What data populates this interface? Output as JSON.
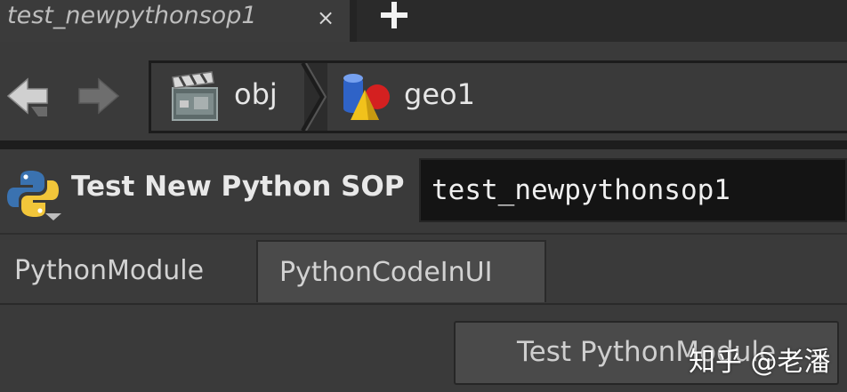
{
  "tab": {
    "title": "test_newpythonsop1",
    "close_glyph": "×"
  },
  "nav": {
    "back_icon": "back-arrow-icon",
    "forward_icon": "forward-arrow-icon"
  },
  "path": {
    "crumbs": [
      {
        "label": "obj",
        "icon": "clapperboard-icon"
      },
      {
        "label": "geo1",
        "icon": "geometry-shapes-icon"
      }
    ]
  },
  "params": {
    "operator_type": "Test New Python SOP",
    "node_name": "test_newpythonsop1"
  },
  "param_tabs": [
    {
      "label": "PythonModule"
    },
    {
      "label": "PythonCodeInUI"
    }
  ],
  "body": {
    "button_label": "Test PythonModule"
  },
  "watermark": "知乎 @老潘",
  "colors": {
    "background": "#3a3a3a",
    "tab_strip": "#2a2a2a",
    "field_bg": "#141414",
    "text": "#e6e6e6"
  }
}
